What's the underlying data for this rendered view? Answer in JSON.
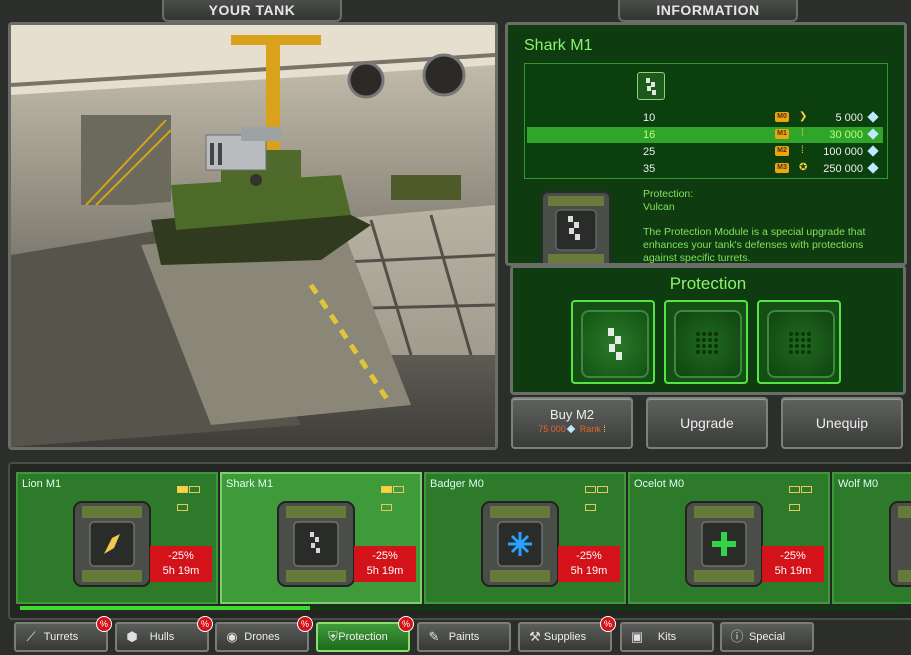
{
  "headers": {
    "your_tank": "YOUR TANK",
    "information": "INFORMATION"
  },
  "info": {
    "title": "Shark M1",
    "rows": [
      {
        "level": "10",
        "mod": "M0",
        "price": "5 000"
      },
      {
        "level": "16",
        "mod": "M1",
        "price": "30 000",
        "active": true
      },
      {
        "level": "25",
        "mod": "M2",
        "price": "100 000"
      },
      {
        "level": "35",
        "mod": "M3",
        "price": "250 000"
      }
    ],
    "protection_label": "Protection:",
    "protection_value": "Vulcan",
    "description": "The Protection Module is a special upgrade that enhances your tank's defenses with protections against specific turrets."
  },
  "protection_panel": {
    "title": "Protection"
  },
  "actions": {
    "buy_label": "Buy M2",
    "buy_price": "75 000",
    "buy_rank": "Rank",
    "upgrade": "Upgrade",
    "unequip": "Unequip"
  },
  "items": [
    {
      "name": "Lion M1",
      "discount": "-25%",
      "timer": "5h 19m",
      "pips": 1,
      "icon": "lion-module-icon",
      "color": "#f2c94c"
    },
    {
      "name": "Shark M1",
      "discount": "-25%",
      "timer": "5h 19m",
      "pips": 1,
      "icon": "shark-module-icon",
      "color": "#d8d8d8",
      "selected": true
    },
    {
      "name": "Badger M0",
      "discount": "-25%",
      "timer": "5h 19m",
      "pips": 0,
      "icon": "badger-module-icon",
      "color": "#2aa0ff"
    },
    {
      "name": "Ocelot M0",
      "discount": "-25%",
      "timer": "5h 19m",
      "pips": 0,
      "icon": "ocelot-module-icon",
      "color": "#34d34a"
    },
    {
      "name": "Wolf M0"
    }
  ],
  "progress": 0.33,
  "nav": [
    {
      "label": "Turrets",
      "icon": "turret-icon",
      "sale": "%"
    },
    {
      "label": "Hulls",
      "icon": "hull-icon",
      "sale": "%"
    },
    {
      "label": "Drones",
      "icon": "drone-icon",
      "sale": "%"
    },
    {
      "label": "Protection",
      "icon": "shield-icon",
      "sale": "%",
      "active": true
    },
    {
      "label": "Paints",
      "icon": "paint-icon"
    },
    {
      "label": "Supplies",
      "icon": "wrench-icon",
      "sale": "%"
    },
    {
      "label": "Kits",
      "icon": "kit-icon"
    },
    {
      "label": "Special",
      "icon": "exclamation-icon"
    }
  ]
}
